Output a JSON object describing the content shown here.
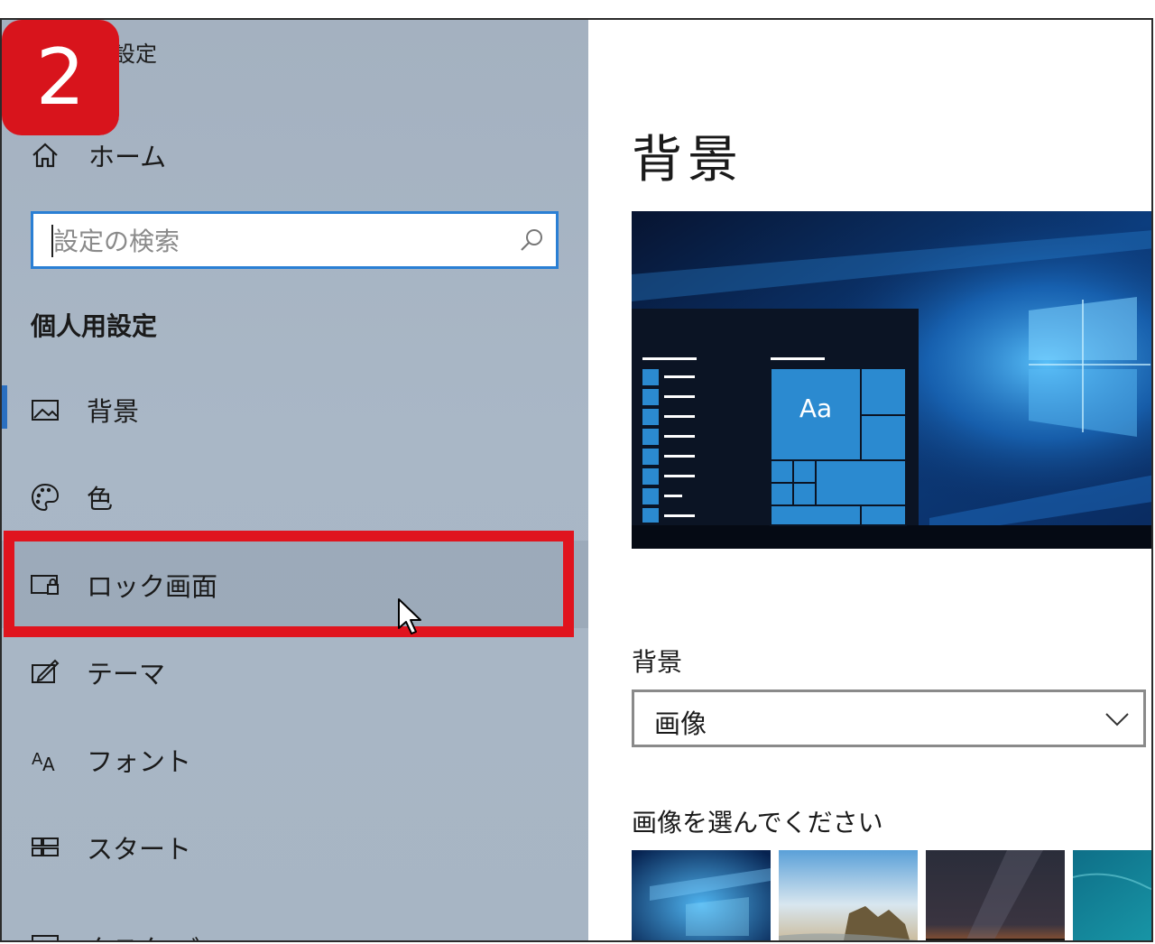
{
  "step_badge": "2",
  "window": {
    "title": "設定"
  },
  "sidebar": {
    "home_label": "ホーム",
    "search_placeholder": "設定の検索",
    "section_title": "個人用設定",
    "items": [
      {
        "label": "背景",
        "icon": "picture-icon"
      },
      {
        "label": "色",
        "icon": "palette-icon"
      },
      {
        "label": "ロック画面",
        "icon": "lock-screen-icon"
      },
      {
        "label": "テーマ",
        "icon": "theme-icon"
      },
      {
        "label": "フォント",
        "icon": "font-icon"
      },
      {
        "label": "スタート",
        "icon": "start-icon"
      },
      {
        "label": "タスク バー",
        "icon": "taskbar-icon"
      }
    ]
  },
  "main": {
    "page_title": "背景",
    "preview_tile_text": "Aa",
    "background_label": "背景",
    "background_value": "画像",
    "choose_label": "画像を選んでください"
  },
  "colors": {
    "accent": "#2a7fd4",
    "highlight": "#e0141e",
    "badge": "#d8141c",
    "tile_blue": "#2b8ad0"
  }
}
